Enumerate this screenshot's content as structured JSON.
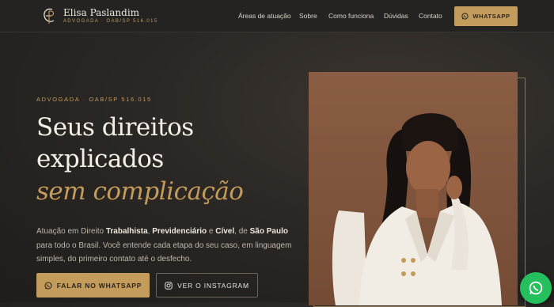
{
  "header": {
    "brand_name": "Elisa Paslandim",
    "brand_subtitle": "ADVOGADA · OAB/SP 516.015",
    "nav": [
      "Áreas de atuação",
      "Sobre",
      "Como funciona",
      "Dúvidas",
      "Contato"
    ],
    "whatsapp_label": "WHATSAPP"
  },
  "hero": {
    "eyebrow": "ADVOGADA · OAB/SP 516.015",
    "title_line1": "Seus direitos",
    "title_line2": "explicados",
    "title_line3": "sem complicação",
    "para_intro": "Atuação em Direito ",
    "area1": "Trabalhista",
    "area2": "Previdenciário",
    "conj_and": " e ",
    "area3": "Cível",
    "conj_of": ", de ",
    "city": "São Paulo",
    "para_rest": " para todo o Brasil. Você entende cada etapa do seu caso, em linguagem simples, do primeiro contato até o desfecho.",
    "cta_whatsapp": "FALAR NO WHATSAPP",
    "cta_instagram": "VER O INSTAGRAM"
  },
  "colors": {
    "accent_gold": "#c39b5b",
    "background": "#2a2724",
    "whatsapp_green": "#25c05d"
  }
}
